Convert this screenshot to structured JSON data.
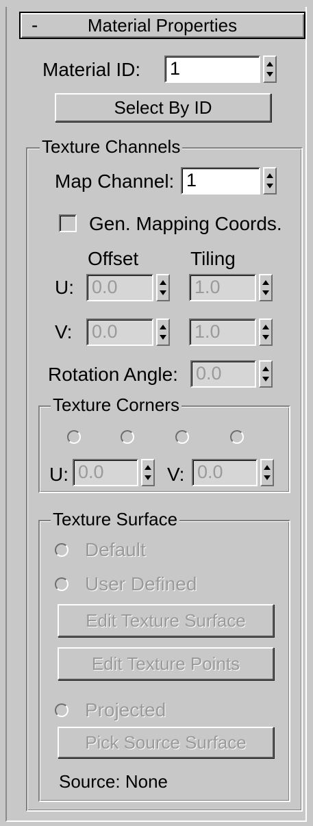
{
  "rollout": {
    "collapse_symbol": "-",
    "title": "Material Properties"
  },
  "material_id": {
    "label": "Material ID:",
    "value": "1"
  },
  "select_by_id": {
    "label": "Select By ID"
  },
  "texture_channels": {
    "title": "Texture Channels",
    "map_channel": {
      "label": "Map Channel:",
      "value": "1"
    },
    "gen_mapping": {
      "label": "Gen. Mapping Coords.",
      "checked": false
    },
    "offset_header": "Offset",
    "tiling_header": "Tiling",
    "u": {
      "label": "U:",
      "offset": "0.0",
      "tiling": "1.0"
    },
    "v": {
      "label": "V:",
      "offset": "0.0",
      "tiling": "1.0"
    },
    "rotation": {
      "label": "Rotation Angle:",
      "value": "0.0"
    }
  },
  "texture_corners": {
    "title": "Texture Corners",
    "corner_count": 4,
    "u": {
      "label": "U:",
      "value": "0.0"
    },
    "v": {
      "label": "V:",
      "value": "0.0"
    }
  },
  "texture_surface": {
    "title": "Texture Surface",
    "default_label": "Default",
    "user_defined_label": "User Defined",
    "edit_surface_label": "Edit Texture Surface",
    "edit_points_label": "Edit Texture Points",
    "projected_label": "Projected",
    "pick_source_label": "Pick Source Surface",
    "source_label": "Source: None"
  }
}
